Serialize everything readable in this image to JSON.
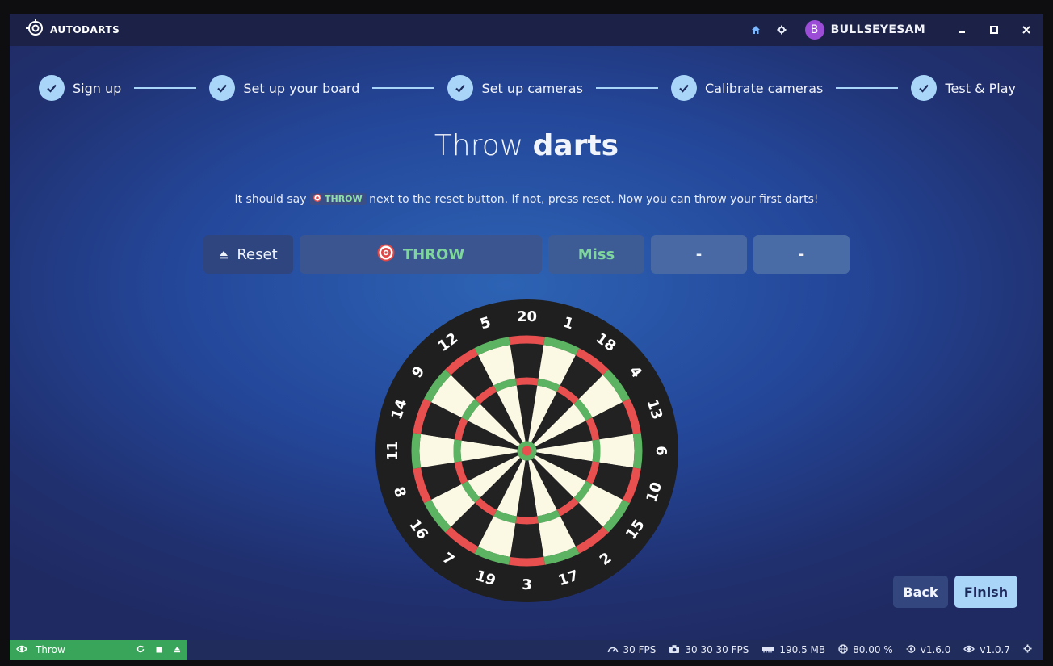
{
  "titlebar": {
    "app_name": "AUTODARTS",
    "username": "BULLSEYESAM",
    "avatar_letter": "B",
    "icons": [
      "home-icon",
      "gear-icon",
      "minimize-icon",
      "maximize-icon",
      "close-icon"
    ]
  },
  "stepper": {
    "steps": [
      {
        "label": "Sign up",
        "state": "done"
      },
      {
        "label": "Set up your board",
        "state": "done"
      },
      {
        "label": "Set up cameras",
        "state": "done"
      },
      {
        "label": "Calibrate cameras",
        "state": "done"
      },
      {
        "label": "Test & Play",
        "state": "done"
      }
    ]
  },
  "main": {
    "heading_light": "Throw",
    "heading_bold": "darts",
    "instructions_before": "It should say",
    "instructions_chip": "THROW",
    "instructions_after": "next to the reset button. If not, press reset. Now you can throw your first darts!"
  },
  "throw_bar": {
    "reset_label": "Reset",
    "status_label": "THROW",
    "dart1": "Miss",
    "dart2": "-",
    "dart3": "-"
  },
  "dartboard": {
    "numbers": [
      20,
      1,
      18,
      4,
      13,
      6,
      10,
      15,
      2,
      17,
      3,
      19,
      7,
      16,
      8,
      11,
      14,
      9,
      12,
      5
    ],
    "colors": {
      "black": "#222222",
      "cream": "#fbf8e4",
      "red": "#e85050",
      "green": "#5cb462",
      "surround": "#1f1f1f"
    }
  },
  "nav": {
    "back_label": "Back",
    "finish_label": "Finish"
  },
  "statusbar": {
    "mode_label": "Throw",
    "fps": "30 FPS",
    "camera_fps": "30 30 30 FPS",
    "memory": "190.5 MB",
    "cpu": "80.00 %",
    "app_version": "v1.6.0",
    "board_version": "v1.0.7"
  },
  "colors": {
    "accent": "#a8d5f8",
    "throw_green": "#7fd69c",
    "status_green": "#38a55a"
  }
}
